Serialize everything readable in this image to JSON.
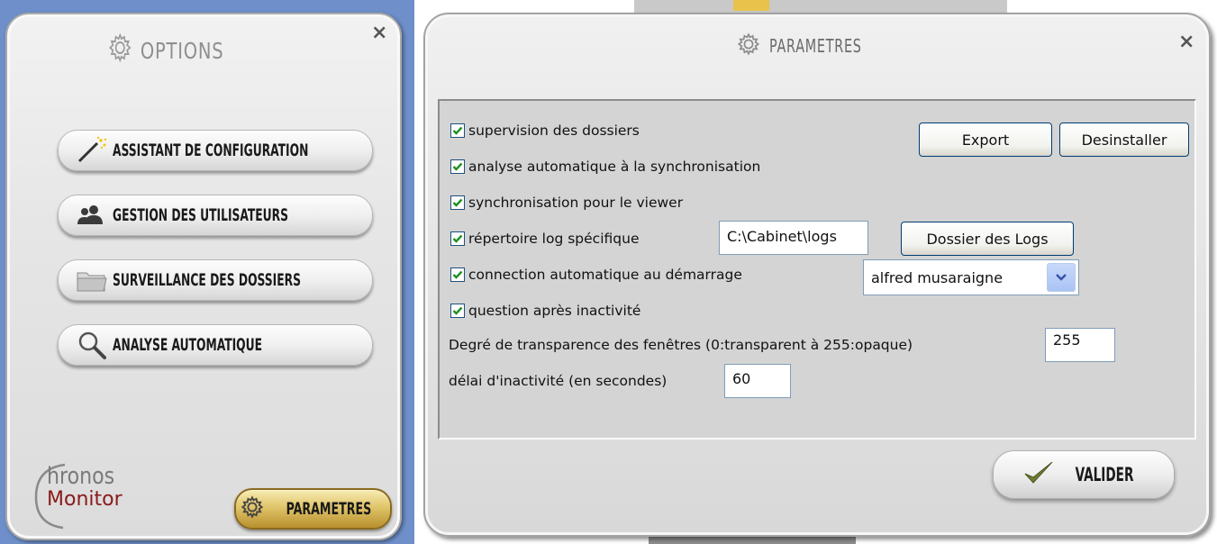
{
  "options_window": {
    "title": "OPTIONS",
    "close_symbol": "×",
    "buttons": [
      {
        "label": "ASSISTANT DE CONFIGURATION",
        "icon": "magic-wand-icon"
      },
      {
        "label": "GESTION DES UTILISATEURS",
        "icon": "users-icon"
      },
      {
        "label": "SURVEILLANCE DES DOSSIERS",
        "icon": "folder-icon"
      },
      {
        "label": "ANALYSE AUTOMATIQUE",
        "icon": "magnifier-icon"
      }
    ],
    "logo": {
      "line1": "hronos",
      "line2": "Monitor"
    },
    "parametres_button": "PARAMETRES"
  },
  "parametres_window": {
    "title": "PARAMETRES",
    "close_symbol": "×",
    "checkboxes": [
      {
        "label": "supervision des dossiers",
        "checked": true
      },
      {
        "label": "analyse automatique à la synchronisation",
        "checked": true
      },
      {
        "label": "synchronisation pour le viewer",
        "checked": true
      },
      {
        "label": "répertoire log spécifique",
        "checked": true
      },
      {
        "label": "connection automatique au démarrage",
        "checked": true
      },
      {
        "label": "question après inactivité",
        "checked": true
      }
    ],
    "export_button": "Export",
    "uninstall_button": "Desinstaller",
    "log_path": "C:\\Cabinet\\logs",
    "log_folder_button": "Dossier des Logs",
    "auto_user": "alfred musaraigne",
    "transparency_label": "Degré de transparence des fenêtres (0:transparent à 255:opaque)",
    "transparency_value": "255",
    "inactivity_label": "délai d'inactivité (en secondes)",
    "inactivity_value": "60",
    "validate_button": "VALIDER"
  },
  "colors": {
    "gold_button": "#d9b95a",
    "check_green": "#1f8f1f",
    "window_bg": "#e4e4e4"
  }
}
